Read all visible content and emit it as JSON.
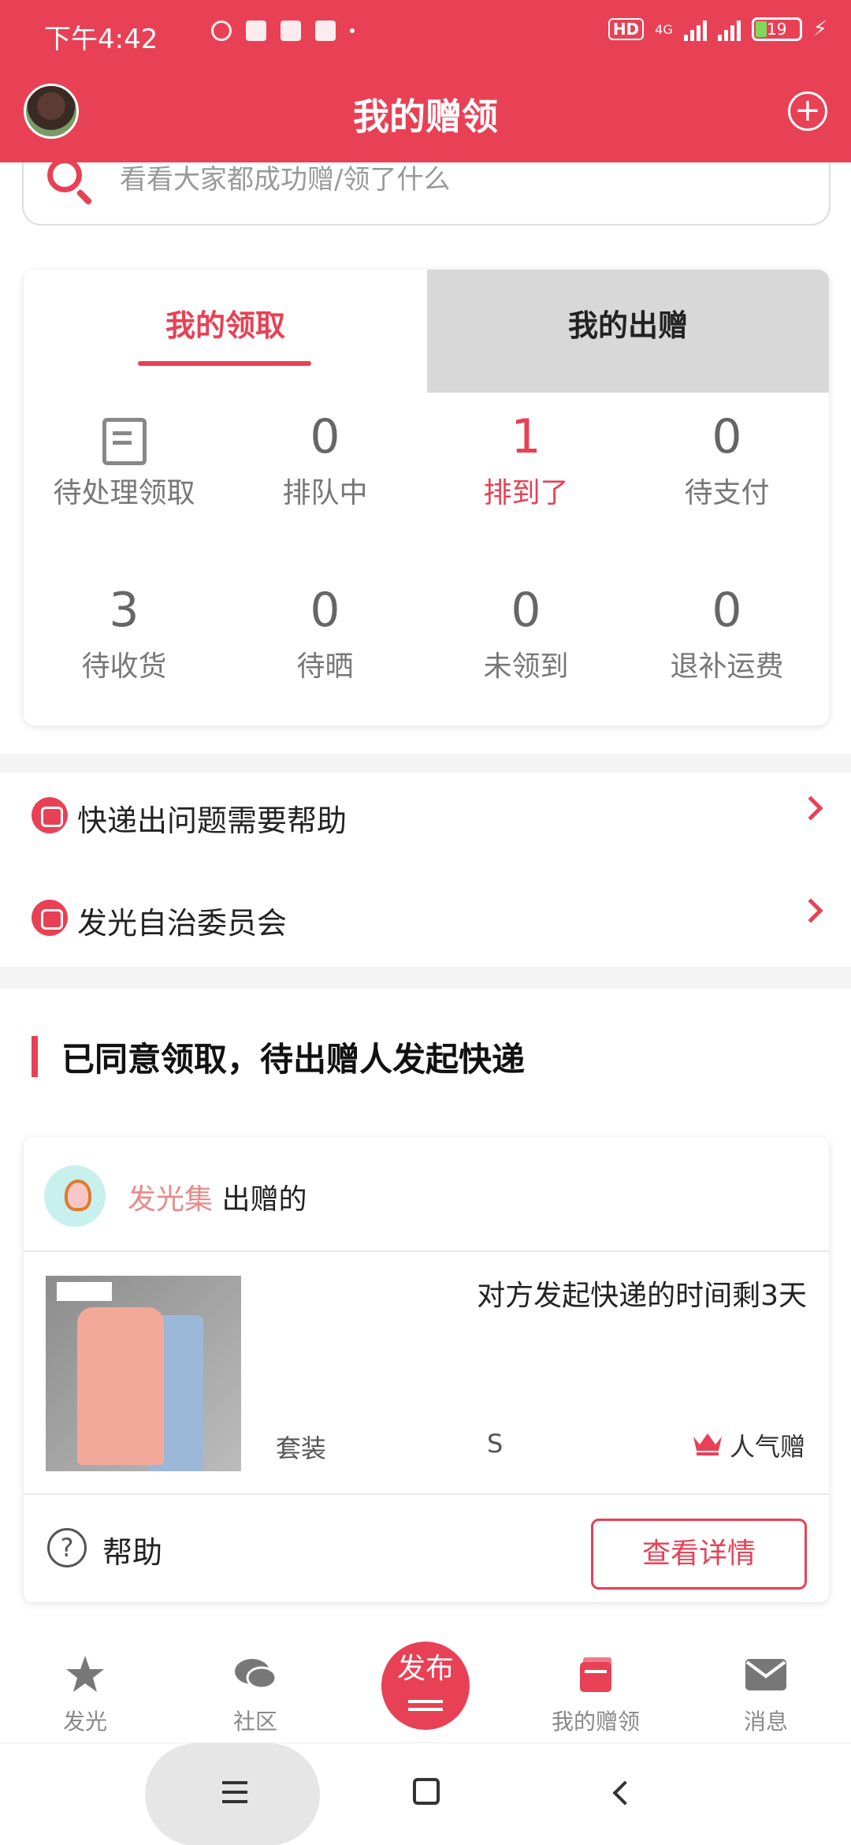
{
  "status_bar": {
    "time": "下午4:42",
    "battery": "19",
    "network": "4G",
    "hd": "HD"
  },
  "header": {
    "title": "我的赠领",
    "plus": "+"
  },
  "search": {
    "placeholder": "看看大家都成功赠/领了什么"
  },
  "tabs": [
    {
      "label": "我的领取",
      "active": true
    },
    {
      "label": "我的出赠",
      "active": false
    }
  ],
  "stats": [
    {
      "value": "",
      "label": "待处理领取",
      "icon": "document-icon"
    },
    {
      "value": "0",
      "label": "排队中"
    },
    {
      "value": "1",
      "label": "排到了",
      "active": true
    },
    {
      "value": "0",
      "label": "待支付"
    },
    {
      "value": "3",
      "label": "待收货"
    },
    {
      "value": "0",
      "label": "待晒"
    },
    {
      "value": "0",
      "label": "未领到"
    },
    {
      "value": "0",
      "label": "退补运费"
    }
  ],
  "links": [
    {
      "label": "快递出问题需要帮助"
    },
    {
      "label": "发光自治委员会"
    }
  ],
  "section": {
    "title": "已同意领取，待出赠人发起快递"
  },
  "card": {
    "giver_name": "发光集",
    "giver_suffix": "出赠的",
    "remaining": "对方发起快递的时间剩3天",
    "category": "套装",
    "size": "S",
    "popular": "人气赠",
    "help": "帮助",
    "detail_button": "查看详情"
  },
  "bottom_nav": [
    {
      "label": "发光",
      "icon": "star-icon"
    },
    {
      "label": "社区",
      "icon": "chat-icon"
    },
    {
      "label": "发布",
      "icon": "publish-icon"
    },
    {
      "label": "我的赠领",
      "icon": "wallet-icon",
      "active": true
    },
    {
      "label": "消息",
      "icon": "mail-icon"
    }
  ],
  "colors": {
    "accent": "#e84155",
    "inactive_tab": "#d8d8d8"
  }
}
